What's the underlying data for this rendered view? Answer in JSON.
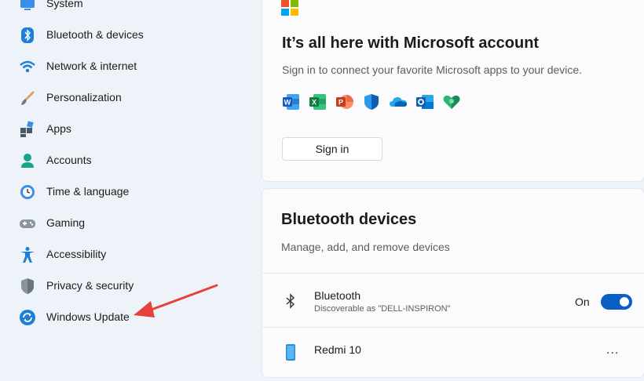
{
  "sidebar": {
    "items": [
      {
        "label": "System"
      },
      {
        "label": "Bluetooth & devices"
      },
      {
        "label": "Network & internet"
      },
      {
        "label": "Personalization"
      },
      {
        "label": "Apps"
      },
      {
        "label": "Accounts"
      },
      {
        "label": "Time & language"
      },
      {
        "label": "Gaming"
      },
      {
        "label": "Accessibility"
      },
      {
        "label": "Privacy & security"
      },
      {
        "label": "Windows Update"
      }
    ]
  },
  "microsoft_account_card": {
    "title": "It’s all here with Microsoft account",
    "subtitle": "Sign in to connect your favorite Microsoft apps to your device.",
    "apps": [
      "word-icon",
      "excel-icon",
      "powerpoint-icon",
      "defender-icon",
      "onedrive-icon",
      "outlook-icon",
      "family-safety-icon"
    ],
    "signin_label": "Sign in"
  },
  "bluetooth_card": {
    "title": "Bluetooth devices",
    "subtitle": "Manage, add, and remove devices",
    "bluetooth_row": {
      "title": "Bluetooth",
      "subtitle": "Discoverable as \"DELL-INSPIRON\"",
      "toggle_label": "On",
      "toggle_on": true
    },
    "device_row": {
      "title": "Redmi 10",
      "more_label": "..."
    }
  },
  "colors": {
    "accent": "#0a5fc4",
    "annotation_arrow": "#e8403a"
  }
}
